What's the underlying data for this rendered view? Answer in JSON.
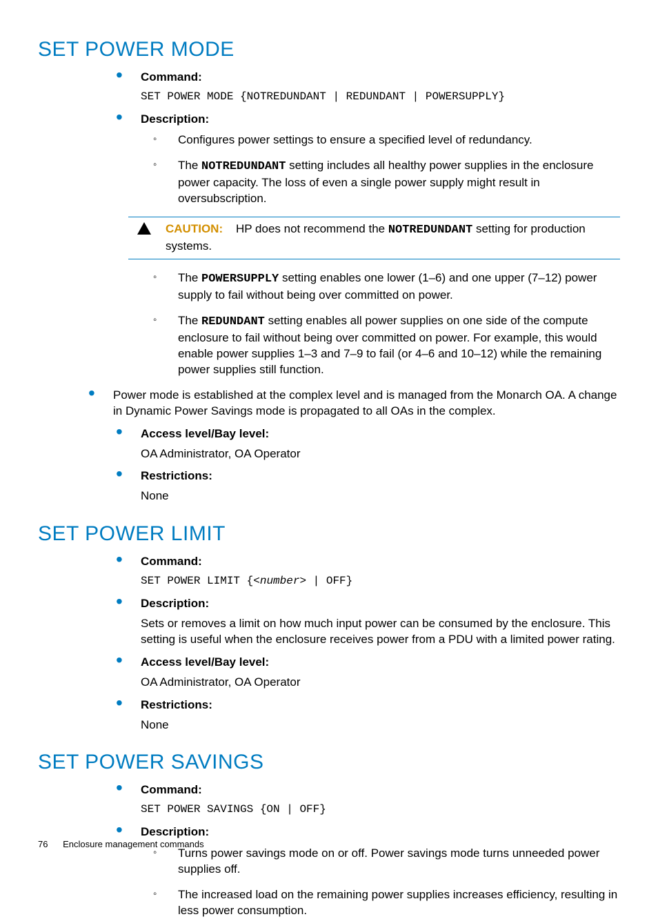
{
  "footer": {
    "page_number": "76",
    "chapter": "Enclosure management commands"
  },
  "labels": {
    "command": "Command:",
    "description": "Description:",
    "access": "Access level/Bay level:",
    "restrictions": "Restrictions:",
    "caution": "CAUTION:"
  },
  "sections": {
    "mode": {
      "title": "SET POWER MODE",
      "command_syntax": "SET POWER MODE {NOTREDUNDANT | REDUNDANT | POWERSUPPLY}",
      "desc_sub": {
        "a": "Configures power settings to ensure a specified level of redundancy.",
        "b_pre": "The ",
        "b_code": "NOTREDUNDANT",
        "b_post": " setting includes all healthy power supplies in the enclosure power capacity. The loss of even a single power supply might result in oversubscription.",
        "caution_pre": "HP does not recommend the ",
        "caution_code": "NOTREDUNDANT",
        "caution_post": " setting for production systems.",
        "c_pre": "The ",
        "c_code": "POWERSUPPLY",
        "c_post": " setting enables one lower (1–6) and one upper (7–12) power supply to fail without being over committed on power.",
        "d_pre": "The ",
        "d_code": "REDUNDANT",
        "d_post": " setting enables all power supplies on one side of the compute enclosure to fail without being over committed on power. For example, this would enable power supplies 1–3 and 7–9 to fail (or 4–6 and 10–12) while the remaining power supplies still function."
      },
      "complex_note": "Power mode is established at the complex level and is managed from the Monarch OA. A change in Dynamic Power Savings mode is propagated to all OAs in the complex.",
      "access_value": "OA Administrator, OA Operator",
      "restrictions_value": "None"
    },
    "limit": {
      "title": "SET POWER LIMIT",
      "command_syntax": "SET POWER LIMIT {<number> | OFF}",
      "description_body": "Sets or removes a limit on how much input power can be consumed by the enclosure. This setting is useful when the enclosure receives power from a PDU with a limited power rating.",
      "access_value": "OA Administrator, OA Operator",
      "restrictions_value": "None"
    },
    "savings": {
      "title": "SET POWER SAVINGS",
      "command_syntax": "SET POWER SAVINGS {ON | OFF}",
      "desc_sub": {
        "a": "Turns power savings mode on or off. Power savings mode turns unneeded power supplies off.",
        "b": "The increased load on the remaining power supplies increases efficiency, resulting in less power consumption."
      }
    }
  }
}
